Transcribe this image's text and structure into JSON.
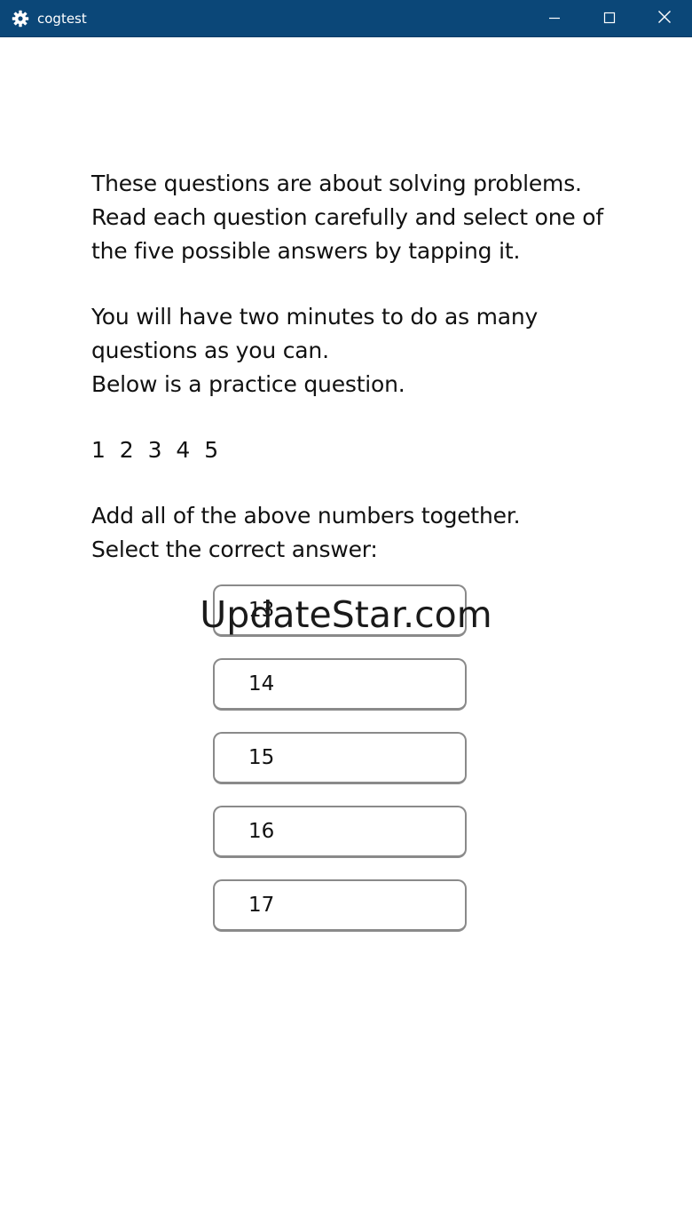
{
  "window": {
    "title": "cogtest",
    "icon": "gear-icon",
    "controls": [
      "minimize-icon",
      "maximize-icon",
      "close-icon"
    ],
    "titlebar_color": "#0b4778"
  },
  "instructions": {
    "line1": "These questions are about solving problems.",
    "line2": "Read each question carefully and select one of",
    "line3": "the five possible answers by tapping it.",
    "line4": "You will have two minutes to do as many",
    "line5": "questions as you can.",
    "line6": "Below is a practice question."
  },
  "question": {
    "numbers": "1  2  3  4  5",
    "prompt1": "Add all of the above numbers together.",
    "prompt2": "Select the correct answer:"
  },
  "answers": [
    {
      "label": "13"
    },
    {
      "label": "14"
    },
    {
      "label": "15"
    },
    {
      "label": "16"
    },
    {
      "label": "17"
    }
  ],
  "watermark": "UpdateStar.com"
}
